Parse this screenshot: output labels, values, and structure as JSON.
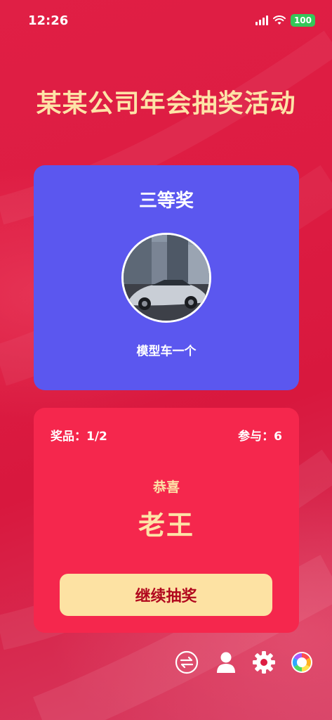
{
  "status_bar": {
    "time": "12:26",
    "battery": "100"
  },
  "page": {
    "title": "某某公司年会抽奖活动"
  },
  "prize": {
    "level": "三等奖",
    "name": "模型车一个",
    "image_alt": "car-photo"
  },
  "result": {
    "prizes_label": "奖品：1/2",
    "participants_label": "参与：6",
    "congrats": "恭喜",
    "winner": "老王",
    "continue_button": "继续抽奖"
  },
  "toolbar": {
    "icons": [
      "swap-icon",
      "user-icon",
      "settings-icon",
      "color-wheel-icon"
    ]
  },
  "colors": {
    "background": "#dd1c42",
    "prize_card": "#5b57ef",
    "result_card": "#f5274d",
    "accent_gold": "#fde3a7",
    "button_text": "#b1081e"
  }
}
